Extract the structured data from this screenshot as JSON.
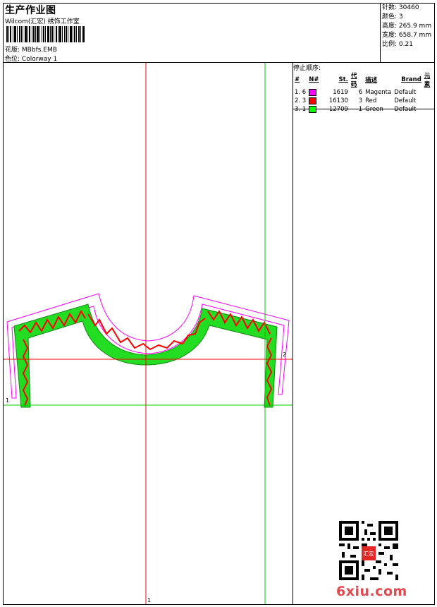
{
  "header": {
    "title": "生产作业图",
    "subtitle": "Wilcom(汇宏) 绣饰工作室",
    "pattern_label": "花版:",
    "pattern_value": "MBbfs.EMB",
    "colorway_label": "色位:",
    "colorway_value": "Colorway 1"
  },
  "stats": [
    {
      "label": "针数:",
      "value": "30460"
    },
    {
      "label": "颜色:",
      "value": "3"
    },
    {
      "label": "高度:",
      "value": "265.9 mm"
    },
    {
      "label": "宽度:",
      "value": "658.7 mm"
    },
    {
      "label": "比例:",
      "value": "0.21"
    }
  ],
  "stop_sequence": {
    "title": "停止顺序:",
    "headers": [
      "#",
      "N#",
      "St.",
      "代码",
      "描述",
      "Brand",
      "元素"
    ],
    "rows": [
      {
        "idx": "1. 6",
        "stitches": "1619",
        "code": "6",
        "desc": "Magenta",
        "brand": "Default",
        "color": "#ff00ff"
      },
      {
        "idx": "2. 3",
        "stitches": "16130",
        "code": "3",
        "desc": "Red",
        "brand": "Default",
        "color": "#ff0000"
      },
      {
        "idx": "3. 1",
        "stitches": "12709",
        "code": "1",
        "desc": "Green",
        "brand": "Default",
        "color": "#00ff00"
      }
    ]
  },
  "canvas": {
    "axis_label_y": "1",
    "axis_label_x": "2",
    "axis_label_bottom": "1"
  },
  "watermark": "6xiu.com",
  "stamp_text": "汇宏"
}
